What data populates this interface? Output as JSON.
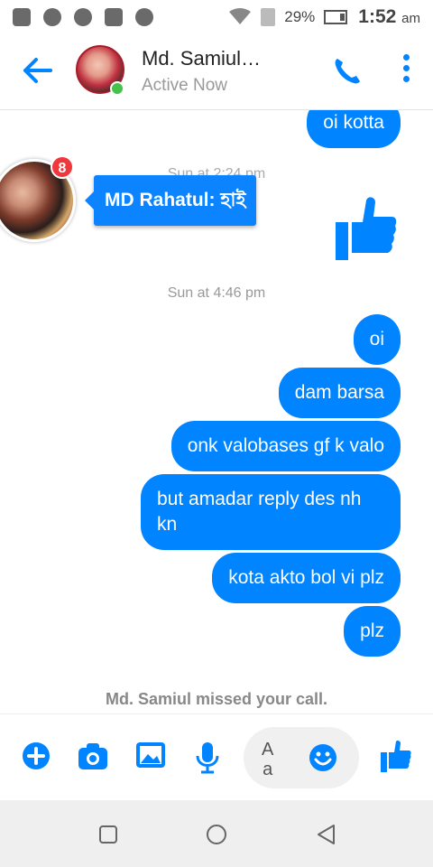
{
  "status_bar": {
    "battery": "29%",
    "time": "1:52",
    "am_pm": "am"
  },
  "header": {
    "name": "Md. Samiul…",
    "status": "Active Now"
  },
  "messages": {
    "top_partial": "oi kotta",
    "timestamp_partial": "Sun at 2:24 pm",
    "timestamp": "Sun at 4:46 pm",
    "sent": [
      "oi",
      "dam barsa",
      "onk valobases gf k valo",
      "but amadar reply des nh kn",
      "kota akto bol vi plz",
      "plz"
    ],
    "system_notice": "Md. Samiul missed your call."
  },
  "chathead": {
    "badge_count": "8",
    "preview": "MD Rahatul: হাই"
  },
  "composer": {
    "aa_top": "A",
    "aa_bottom": "a"
  },
  "colors": {
    "brand": "#0084ff",
    "online": "#44c24a",
    "badge": "#f0373b"
  }
}
